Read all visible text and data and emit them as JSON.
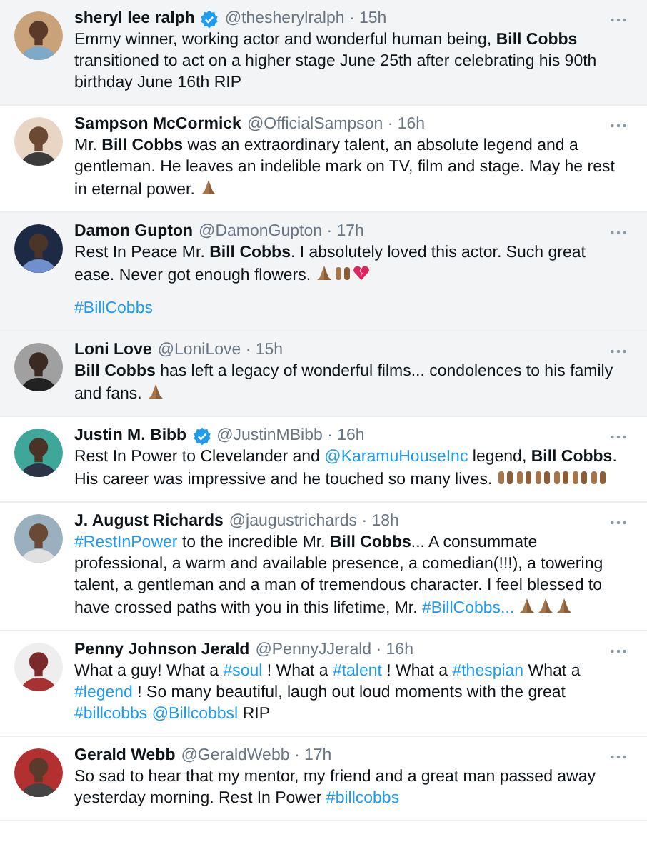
{
  "tweets": [
    {
      "name": "sheryl lee ralph",
      "verified": true,
      "byline": "@thesherylralph · 15h",
      "highlighted": true,
      "paragraphs": [
        [
          {
            "kind": "text",
            "text": "Emmy winner, working actor and wonderful human  being, **Bill Cobbs** transitioned to act on a higher stage June 25th after celebrating his 90th birthday June 16th RIP"
          }
        ]
      ]
    },
    {
      "name": "Sampson McCormick",
      "verified": false,
      "byline": "@OfficialSampson · 16h",
      "highlighted": false,
      "paragraphs": [
        [
          {
            "kind": "text",
            "text": "Mr. **Bill Cobbs** was an extraordinary talent, an absolute legend and a gentleman. He leaves an indelible mark on TV, film and stage. May he rest in eternal power."
          },
          {
            "kind": "pray"
          }
        ]
      ]
    },
    {
      "name": "Damon Gupton",
      "verified": false,
      "byline": "@DamonGupton · 17h",
      "highlighted": true,
      "paragraphs": [
        [
          {
            "kind": "text",
            "text": "Rest In Peace Mr. **Bill Cobbs**. I absolutely loved this actor. Such great ease. Never got enough flowers."
          },
          {
            "kind": "pray"
          },
          {
            "kind": "raised-hands"
          },
          {
            "kind": "broken-heart"
          }
        ],
        [
          {
            "kind": "link",
            "text": "#BillCobbs"
          }
        ]
      ]
    },
    {
      "name": "Loni Love",
      "verified": false,
      "byline": "@LoniLove · 15h",
      "highlighted": true,
      "paragraphs": [
        [
          {
            "kind": "text",
            "text": "**Bill Cobbs** has left a legacy of wonderful films... condolences to his family and fans."
          },
          {
            "kind": "pray"
          }
        ]
      ]
    },
    {
      "name": "Justin M. Bibb",
      "verified": true,
      "byline": "@JustinMBibb · 16h",
      "highlighted": false,
      "paragraphs": [
        [
          {
            "kind": "text",
            "text": "Rest In Power to Clevelander and"
          },
          {
            "kind": "link",
            "text": "@KaramuHouseInc"
          },
          {
            "kind": "text",
            "text": "legend, **Bill Cobbs**. His career was impressive and he touched so many lives."
          },
          {
            "kind": "raised-hands"
          },
          {
            "kind": "raised-hands"
          },
          {
            "kind": "raised-hands"
          },
          {
            "kind": "raised-hands"
          },
          {
            "kind": "raised-hands"
          },
          {
            "kind": "raised-hands"
          }
        ]
      ]
    },
    {
      "name": "J. August Richards",
      "verified": false,
      "byline": "@jaugustrichards · 18h",
      "highlighted": false,
      "paragraphs": [
        [
          {
            "kind": "link",
            "text": "#RestInPower"
          },
          {
            "kind": "text",
            "text": "to the incredible Mr. **Bill Cobbs**... A consummate professional, a warm and available presence, a comedian(!!!), a towering talent, a gentleman and a man of tremendous character. I feel blessed to have crossed paths with you in this lifetime, Mr."
          },
          {
            "kind": "link",
            "text": "#BillCobbs..."
          },
          {
            "kind": "pray"
          },
          {
            "kind": "pray"
          },
          {
            "kind": "pray"
          }
        ]
      ]
    },
    {
      "name": "Penny Johnson Jerald",
      "verified": false,
      "byline": "@PennyJJerald · 16h",
      "highlighted": false,
      "paragraphs": [
        [
          {
            "kind": "text",
            "text": "What a guy! What a"
          },
          {
            "kind": "link",
            "text": "#soul"
          },
          {
            "kind": "text",
            "text": "! What a"
          },
          {
            "kind": "link",
            "text": "#talent"
          },
          {
            "kind": "text",
            "text": "! What a"
          },
          {
            "kind": "link",
            "text": "#thespian"
          },
          {
            "kind": "text",
            "text": "What a"
          },
          {
            "kind": "link",
            "text": "#legend"
          },
          {
            "kind": "text",
            "text": "! So many beautiful, laugh out loud moments with the great"
          },
          {
            "kind": "link",
            "text": "#billcobbs"
          },
          {
            "kind": "link",
            "text": "@Billcobbsl"
          },
          {
            "kind": "text",
            "text": "RIP"
          }
        ]
      ]
    },
    {
      "name": "Gerald Webb",
      "verified": false,
      "byline": "@GeraldWebb · 17h",
      "highlighted": false,
      "paragraphs": [
        [
          {
            "kind": "text",
            "text": "So sad to hear that my mentor, my friend and a great man passed away yesterday morning. Rest In Power"
          },
          {
            "kind": "link",
            "text": "#billcobbs"
          }
        ]
      ]
    }
  ]
}
